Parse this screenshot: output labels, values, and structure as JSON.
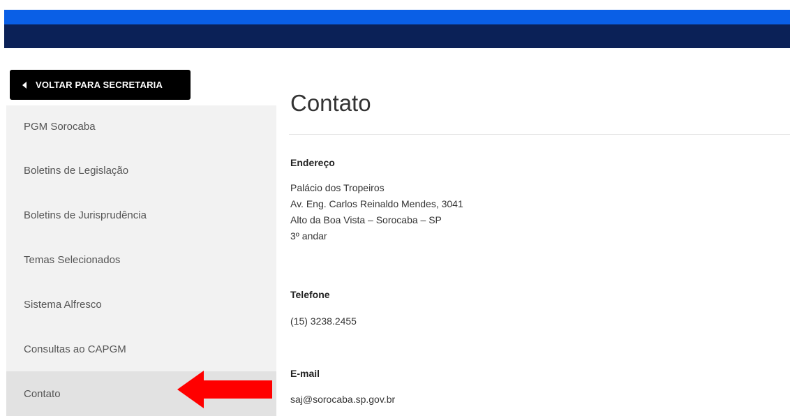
{
  "back_button": {
    "label": "VOLTAR PARA SECRETARIA",
    "icon": "caret-left-icon"
  },
  "sidebar": {
    "items": [
      {
        "label": "PGM Sorocaba"
      },
      {
        "label": "Boletins de Legislação"
      },
      {
        "label": "Boletins de Jurisprudência"
      },
      {
        "label": "Temas Selecionados"
      },
      {
        "label": "Sistema Alfresco"
      },
      {
        "label": "Consultas ao CAPGM"
      },
      {
        "label": "Contato",
        "active": true
      }
    ]
  },
  "main": {
    "title": "Contato",
    "address": {
      "heading": "Endereço",
      "lines": [
        "Palácio dos Tropeiros",
        "Av. Eng. Carlos Reinaldo Mendes, 3041",
        "Alto da Boa Vista – Sorocaba – SP",
        "3º andar"
      ]
    },
    "phone": {
      "heading": "Telefone",
      "value": "(15) 3238.2455"
    },
    "email": {
      "heading": "E-mail",
      "value": "saj@sorocaba.sp.gov.br"
    }
  },
  "colors": {
    "top_stripe": "#0a5fe6",
    "top_bar": "#0b2157",
    "sidebar_bg": "#f2f2f2",
    "sidebar_active_bg": "#e2e2e2",
    "annotation_arrow": "#ff0000"
  }
}
